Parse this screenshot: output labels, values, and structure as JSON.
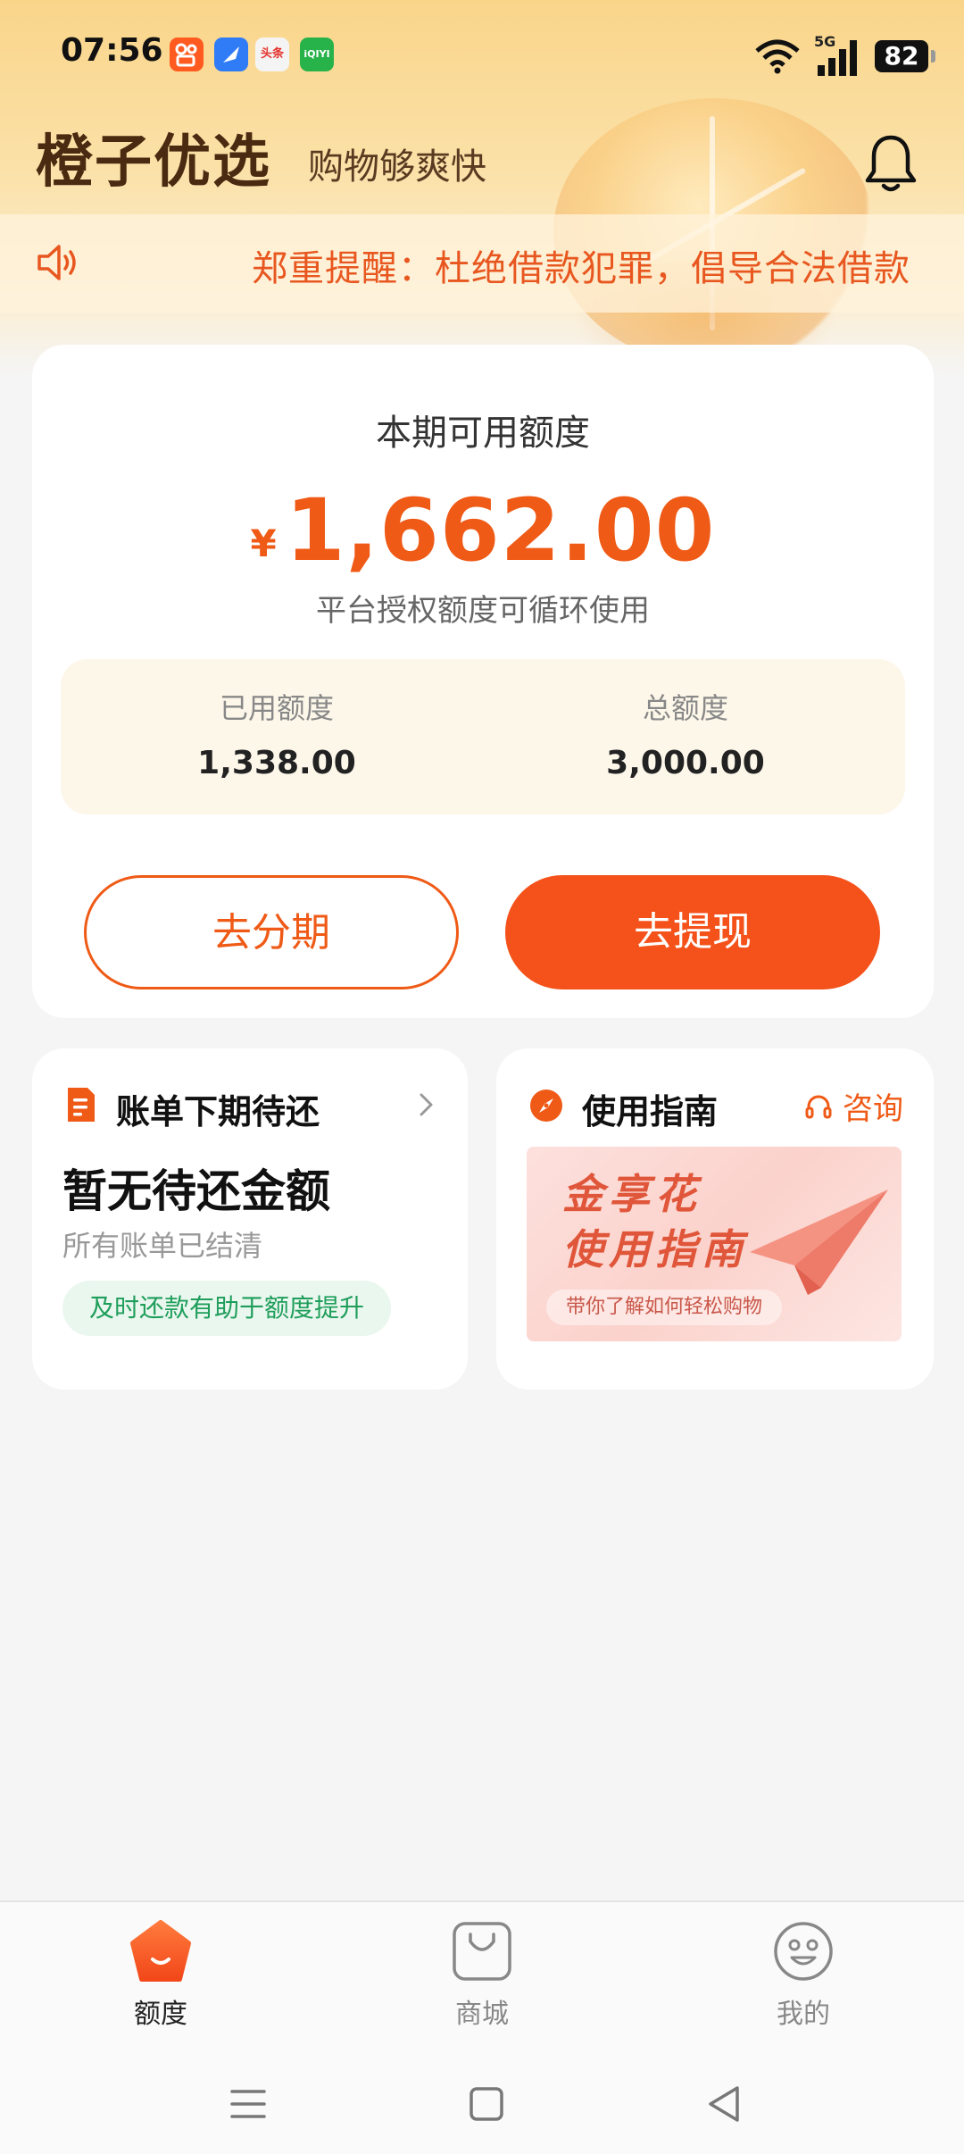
{
  "status_bar": {
    "time": "07:56",
    "apps": [
      "kuaishou-icon",
      "browser-icon",
      "toutiao-icon",
      "iqiyi-icon"
    ],
    "toutiao_label": "头条",
    "iqiyi_label": "iQIYI",
    "network": "5G",
    "battery": "82"
  },
  "header": {
    "title": "橙子优选",
    "slogan": "购物够爽快"
  },
  "notice": {
    "text": "郑重提醒：杜绝借款犯罪，倡导合法借款"
  },
  "credit": {
    "title": "本期可用额度",
    "currency": "¥",
    "available": "1,662.00",
    "note": "平台授权额度可循环使用",
    "used_label": "已用额度",
    "used_value": "1,338.00",
    "total_label": "总额度",
    "total_value": "3,000.00",
    "installment_button": "去分期",
    "withdraw_button": "去提现"
  },
  "bill": {
    "title": "账单下期待还",
    "main": "暂无待还金额",
    "sub": "所有账单已结清",
    "tag": "及时还款有助于额度提升"
  },
  "guide": {
    "title": "使用指南",
    "consult": "咨询",
    "banner_line1": "金享花",
    "banner_line2": "使用指南",
    "banner_pill": "带你了解如何轻松购物"
  },
  "nav": {
    "items": [
      {
        "label": "额度",
        "icon": "credit-icon",
        "active": true
      },
      {
        "label": "商城",
        "icon": "shopping-bag-icon",
        "active": false
      },
      {
        "label": "我的",
        "icon": "profile-face-icon",
        "active": false
      }
    ]
  },
  "colors": {
    "accent": "#f4521a",
    "title_brown": "#4a2a10",
    "green_tag": "#1f9e5b"
  }
}
